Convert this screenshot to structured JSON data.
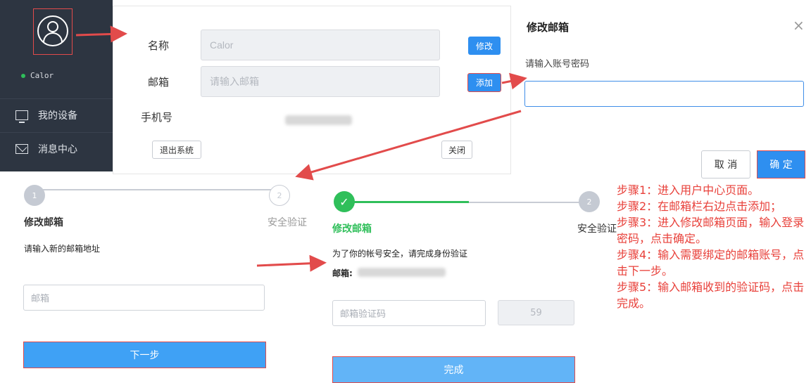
{
  "sidebar": {
    "username": "Calor",
    "items": [
      {
        "label": "我的设备",
        "icon": "monitor-icon"
      },
      {
        "label": "消息中心",
        "icon": "mail-icon"
      }
    ]
  },
  "profile": {
    "name_label": "名称",
    "name_value": "Calor",
    "edit_label": "修改",
    "email_label": "邮箱",
    "email_placeholder": "请输入邮箱",
    "add_label": "添加",
    "phone_label": "手机号",
    "logout_label": "退出系统",
    "close_label": "关闭"
  },
  "modal": {
    "title": "修改邮箱",
    "close_glyph": "×",
    "label": "请输入账号密码",
    "cancel_label": "取 消",
    "ok_label": "确 定"
  },
  "step_left": {
    "step1_num": "1",
    "step2_num": "2",
    "step1_label": "修改邮箱",
    "step2_label": "安全验证",
    "instruction": "请输入新的邮箱地址",
    "email_placeholder": "邮箱",
    "next_label": "下一步"
  },
  "step_right": {
    "step2_num": "2",
    "step1_label": "修改邮箱",
    "step2_label": "安全验证",
    "instruction": "为了你的帐号安全，请完成身份验证",
    "email_label": "邮箱:",
    "code_placeholder": "邮箱验证码",
    "countdown": "59",
    "finish_label": "完成"
  },
  "notes": [
    "步骤1：进入用户中心页面。",
    "步骤2：在邮箱栏右边点击添加；",
    "步骤3：进入修改邮箱页面，输入登录密码，点击确定。",
    "步骤4：输入需要绑定的邮箱账号，点击下一步。",
    "步骤5：输入邮箱收到的验证码，点击完成。"
  ],
  "colors": {
    "sidebar_bg": "#2d3541",
    "primary": "#2e8ff0",
    "step_done": "#2fbf5a",
    "arrow": "#e24b4b",
    "note_text": "#e8403a"
  }
}
